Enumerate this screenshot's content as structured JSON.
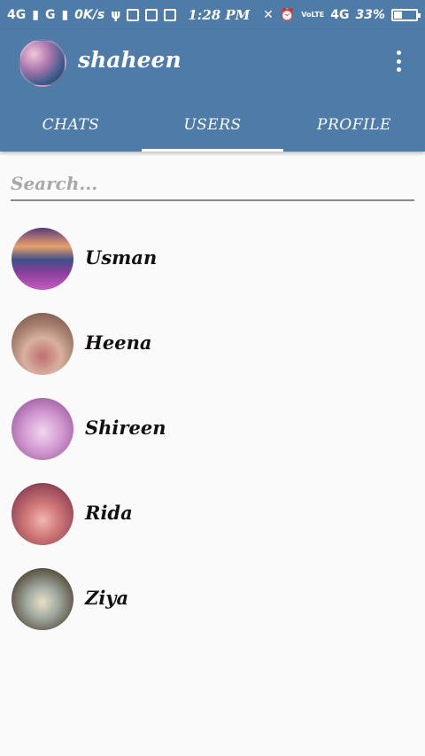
{
  "status_bar": {
    "network1": "4G",
    "network2": "G",
    "speed": "0K/s",
    "time": "1:28 PM",
    "volte": "VoLTE",
    "network3": "4G",
    "battery_text": "33%",
    "battery_level": 0.33
  },
  "app": {
    "title": "shaheen",
    "accent_color": "#4f7ba8"
  },
  "tabs": [
    {
      "label": "CHATS",
      "active": false
    },
    {
      "label": "USERS",
      "active": true
    },
    {
      "label": "PROFILE",
      "active": false
    }
  ],
  "search": {
    "placeholder": "Search...",
    "value": ""
  },
  "users": [
    {
      "name": "Usman"
    },
    {
      "name": "Heena"
    },
    {
      "name": "Shireen"
    },
    {
      "name": "Rida"
    },
    {
      "name": "Ziya"
    }
  ]
}
